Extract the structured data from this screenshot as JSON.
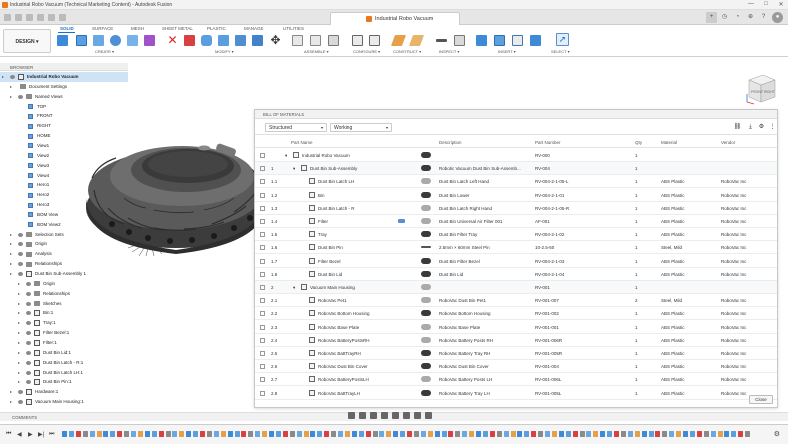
{
  "window": {
    "title": "Industrial Robo Vacuum (Technical Marketing Content) - Autodesk Fusion",
    "controls": [
      "—",
      "□",
      "✕"
    ]
  },
  "doc_tab": {
    "label": "Industrial Robo Vacuum"
  },
  "ribbon": {
    "workspace": "DESIGN ▾",
    "tabs": [
      "SOLID",
      "SURFACE",
      "MESH",
      "SHEET METAL",
      "PLASTIC",
      "MANAGE",
      "UTILITIES"
    ],
    "groups": [
      "CREATE ▾",
      "MODIFY ▾",
      "ASSEMBLE ▾",
      "CONFIGURE ▾",
      "CONSTRUCT ▾",
      "INSPECT ▾",
      "INSERT ▾",
      "SELECT ▾"
    ]
  },
  "browser": {
    "title": "BROWSER",
    "items": [
      {
        "label": "Industrial Robo Vacuum",
        "depth": 0,
        "kind": "comp",
        "selected": true
      },
      {
        "label": "Document Settings",
        "depth": 1,
        "kind": "gear"
      },
      {
        "label": "Named Views",
        "depth": 1,
        "kind": "folder"
      },
      {
        "label": "TOP",
        "depth": 2,
        "kind": "view"
      },
      {
        "label": "FRONT",
        "depth": 2,
        "kind": "view"
      },
      {
        "label": "RIGHT",
        "depth": 2,
        "kind": "view"
      },
      {
        "label": "HOME",
        "depth": 2,
        "kind": "view"
      },
      {
        "label": "View1",
        "depth": 2,
        "kind": "view"
      },
      {
        "label": "View2",
        "depth": 2,
        "kind": "view"
      },
      {
        "label": "View3",
        "depth": 2,
        "kind": "view"
      },
      {
        "label": "View4",
        "depth": 2,
        "kind": "view"
      },
      {
        "label": "Hero1",
        "depth": 2,
        "kind": "view"
      },
      {
        "label": "Hero2",
        "depth": 2,
        "kind": "view"
      },
      {
        "label": "Hero3",
        "depth": 2,
        "kind": "view"
      },
      {
        "label": "BOM View",
        "depth": 2,
        "kind": "view"
      },
      {
        "label": "BOM View2",
        "depth": 2,
        "kind": "view"
      },
      {
        "label": "Selection Sets",
        "depth": 1,
        "kind": "folder"
      },
      {
        "label": "Origin",
        "depth": 1,
        "kind": "folder"
      },
      {
        "label": "Analysis",
        "depth": 1,
        "kind": "folder"
      },
      {
        "label": "Relationships",
        "depth": 1,
        "kind": "folder"
      },
      {
        "label": "Dust Bin Sub-Assembly 1",
        "depth": 1,
        "kind": "comp"
      },
      {
        "label": "Origin",
        "depth": 2,
        "kind": "folder"
      },
      {
        "label": "Relationships",
        "depth": 2,
        "kind": "folder"
      },
      {
        "label": "Sketches",
        "depth": 2,
        "kind": "folder"
      },
      {
        "label": "Bin:1",
        "depth": 2,
        "kind": "comp"
      },
      {
        "label": "Tray:1",
        "depth": 2,
        "kind": "comp"
      },
      {
        "label": "Filter Bezel:1",
        "depth": 2,
        "kind": "comp"
      },
      {
        "label": "Filter:1",
        "depth": 2,
        "kind": "comp"
      },
      {
        "label": "Dust Bin Lid:1",
        "depth": 2,
        "kind": "comp"
      },
      {
        "label": "Dust Bin Latch - R:1",
        "depth": 2,
        "kind": "comp"
      },
      {
        "label": "Dust Bin Latch LH:1",
        "depth": 2,
        "kind": "comp"
      },
      {
        "label": "Dust Bin Pin:1",
        "depth": 2,
        "kind": "comp"
      },
      {
        "label": "Hardware:1",
        "depth": 1,
        "kind": "comp"
      },
      {
        "label": "Vacuum Main Housing:1",
        "depth": 1,
        "kind": "comp"
      }
    ]
  },
  "bom": {
    "title": "BILL OF MATERIALS",
    "view_select": "Structured",
    "state_select": "Working",
    "columns": [
      "Part Name",
      "Description",
      "Part Number",
      "Qty",
      "Material",
      "Vendor"
    ],
    "rows": [
      {
        "num": "",
        "name": "Industrial Robo Vacuum",
        "desc": "",
        "pn": "RV-000",
        "qty": "1",
        "mat": "",
        "vendor": "",
        "level": 0,
        "expander": "▾",
        "thumb": "dark"
      },
      {
        "num": "1",
        "name": "Dust Bin Sub-Assembly",
        "desc": "Robotic Vacuum Dust Bin Sub-Assemb...",
        "pn": "RV-004",
        "qty": "1",
        "mat": "",
        "vendor": "",
        "level": 1,
        "expander": "▾",
        "thumb": "dark"
      },
      {
        "num": "1.1",
        "name": "Dust Bin Latch LH",
        "desc": "Dust Bin Latch Left Hand",
        "pn": "RV-004-2-1-05-L",
        "qty": "1",
        "mat": "ABS Plastic",
        "vendor": "RoboVac Inc",
        "level": 2,
        "expander": "",
        "thumb": "light"
      },
      {
        "num": "1.2",
        "name": "Bin",
        "desc": "Dust Bin Lower",
        "pn": "RV-004-2-1-01",
        "qty": "1",
        "mat": "ABS Plastic",
        "vendor": "RoboVac Inc",
        "level": 2,
        "expander": "",
        "thumb": "dark"
      },
      {
        "num": "1.3",
        "name": "Dust Bin Latch - R",
        "desc": "Dust Bin Latch Right Hand",
        "pn": "RV-004-2-1-05-R",
        "qty": "1",
        "mat": "ABS Plastic",
        "vendor": "RoboVac Inc",
        "level": 2,
        "expander": "",
        "thumb": "light"
      },
      {
        "num": "1.4",
        "name": "Filter",
        "desc": "Dust Bin Universal Air Filter 001",
        "pn": "AF-001",
        "qty": "1",
        "mat": "ABS Plastic",
        "vendor": "RoboVac Inc",
        "level": 2,
        "expander": "",
        "thumb": "light",
        "link": true
      },
      {
        "num": "1.5",
        "name": "Tray",
        "desc": "Dust Bin Filter Tray",
        "pn": "RV-004-2-1-02",
        "qty": "1",
        "mat": "ABS Plastic",
        "vendor": "RoboVac Inc",
        "level": 2,
        "expander": "",
        "thumb": "dark"
      },
      {
        "num": "1.6",
        "name": "Dust Bin Pin",
        "desc": "2.5mm × 60mm Steel Pin",
        "pn": "10-2.5-60",
        "qty": "1",
        "mat": "Steel, Mild",
        "vendor": "RoboVac Inc",
        "level": 2,
        "expander": "",
        "thumb": "thin"
      },
      {
        "num": "1.7",
        "name": "Filter Bezel",
        "desc": "Dust Bin Filter Bezel",
        "pn": "RV-004-2-1-03",
        "qty": "1",
        "mat": "ABS Plastic",
        "vendor": "RoboVac Inc",
        "level": 2,
        "expander": "",
        "thumb": "dark"
      },
      {
        "num": "1.8",
        "name": "Dust Bin Lid",
        "desc": "Dust Bin Lid",
        "pn": "RV-004-2-1-04",
        "qty": "1",
        "mat": "ABS Plastic",
        "vendor": "RoboVac Inc",
        "level": 2,
        "expander": "",
        "thumb": "dark"
      },
      {
        "num": "2",
        "name": "Vacuum Main Housing",
        "desc": "",
        "pn": "RV-001",
        "qty": "1",
        "mat": "",
        "vendor": "",
        "level": 1,
        "expander": "▾",
        "thumb": "light"
      },
      {
        "num": "2.1",
        "name": "RoboVac Pet1",
        "desc": "RoboVac Dust Bin Pet1",
        "pn": "RV-001-007",
        "qty": "2",
        "mat": "Steel, Mild",
        "vendor": "RoboVac Inc",
        "level": 2,
        "expander": "",
        "thumb": "light"
      },
      {
        "num": "2.2",
        "name": "RoboVac Bottom Housing",
        "desc": "RoboVac Bottom Housing",
        "pn": "RV-001-002",
        "qty": "1",
        "mat": "ABS Plastic",
        "vendor": "RoboVac Inc",
        "level": 2,
        "expander": "",
        "thumb": "dark"
      },
      {
        "num": "2.3",
        "name": "RoboVac Base Plate",
        "desc": "RoboVac Base Plate",
        "pn": "RV-001-001",
        "qty": "1",
        "mat": "ABS Plastic",
        "vendor": "RoboVac Inc",
        "level": 2,
        "expander": "",
        "thumb": "light"
      },
      {
        "num": "2.4",
        "name": "RoboVac BatteryPostsRH",
        "desc": "RoboVac Battery Posts RH",
        "pn": "RV-001-006R",
        "qty": "1",
        "mat": "ABS Plastic",
        "vendor": "RoboVac Inc",
        "level": 2,
        "expander": "",
        "thumb": "light"
      },
      {
        "num": "2.5",
        "name": "RoboVac BattTrayRH",
        "desc": "RoboVac Battery Tray RH",
        "pn": "RV-001-005R",
        "qty": "1",
        "mat": "ABS Plastic",
        "vendor": "RoboVac Inc",
        "level": 2,
        "expander": "",
        "thumb": "dark"
      },
      {
        "num": "2.6",
        "name": "RoboVac Dust Bin Cover",
        "desc": "RoboVac Dust Bin Cover",
        "pn": "RV-001-004",
        "qty": "1",
        "mat": "ABS Plastic",
        "vendor": "RoboVac Inc",
        "level": 2,
        "expander": "",
        "thumb": "dark"
      },
      {
        "num": "2.7",
        "name": "RoboVac BatteryPostsLH",
        "desc": "RoboVac Battery Posts LH",
        "pn": "RV-001-006L",
        "qty": "1",
        "mat": "ABS Plastic",
        "vendor": "RoboVac Inc",
        "level": 2,
        "expander": "",
        "thumb": "light"
      },
      {
        "num": "2.8",
        "name": "RoboVac BattTrayLH",
        "desc": "RoboVac Battery Tray LH",
        "pn": "RV-001-005L",
        "qty": "1",
        "mat": "ABS Plastic",
        "vendor": "RoboVac Inc",
        "level": 2,
        "expander": "",
        "thumb": "dark"
      }
    ],
    "close_label": "Close"
  },
  "viewcube": {
    "face_front": "FRONT",
    "face_right": "RIGHT"
  },
  "comments": {
    "label": "COMMENTS"
  },
  "colors": {
    "accent": "#1a6fc9",
    "brand": "#e8771e"
  }
}
